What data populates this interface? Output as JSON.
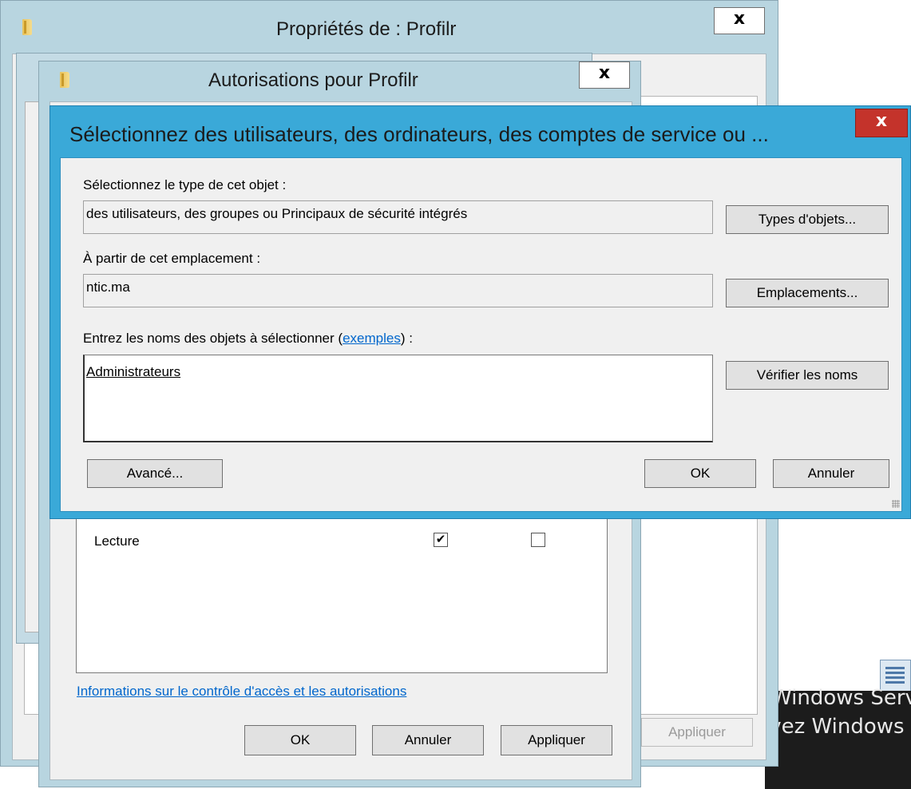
{
  "desktop": {
    "text_line1": "Windows Serv",
    "text_line2": "ivez Windows v"
  },
  "properties_window": {
    "title": "Propriétés de : Profilr",
    "close_label": "x",
    "apply_label": "Appliquer"
  },
  "permissions_window": {
    "title": "Autorisations pour Profilr",
    "close_label": "x",
    "permission_rows": [
      {
        "name": "Lecture",
        "allow": true,
        "deny": false
      }
    ],
    "help_link": "Informations sur le contrôle d'accès et les autorisations",
    "buttons": {
      "ok": "OK",
      "cancel": "Annuler",
      "apply": "Appliquer"
    }
  },
  "select_dialog": {
    "title": "Sélectionnez des utilisateurs, des ordinateurs, des comptes de service ou ...",
    "close_label": "x",
    "object_type_label": "Sélectionnez le type de cet objet :",
    "object_type_value": "des utilisateurs, des groupes ou Principaux de sécurité intégrés",
    "object_types_button": "Types d'objets...",
    "location_label": "À partir de cet emplacement :",
    "location_value": "ntic.ma",
    "locations_button": "Emplacements...",
    "names_label_prefix": "Entrez les noms des objets à sélectionner (",
    "names_label_link": "exemples",
    "names_label_suffix": ") :",
    "names_value": "Administrateurs",
    "check_names_button": "Vérifier les noms",
    "advanced_button": "Avancé...",
    "ok_button": "OK",
    "cancel_button": "Annuler"
  },
  "colors": {
    "frame_blue": "#b8d5e0",
    "active_frame": "#3aa9d8",
    "close_red": "#c4332b",
    "link_blue": "#0066cc"
  }
}
